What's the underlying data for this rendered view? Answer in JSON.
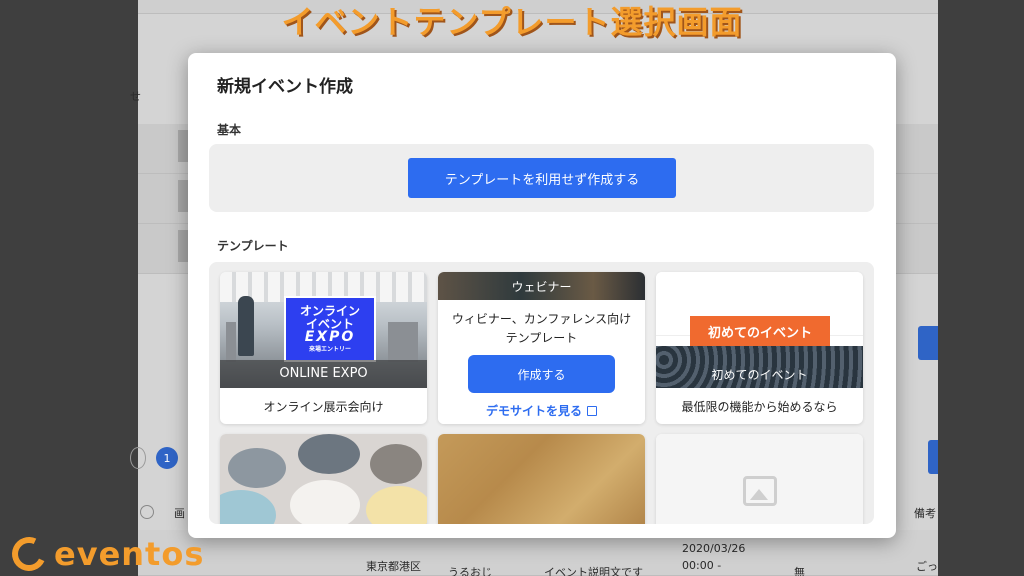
{
  "banner": {
    "title": "イベントテンプレート選択画面"
  },
  "background": {
    "header_fragment": "せ",
    "pagination_current": "1",
    "table_header_left": "画",
    "table_header_right": "備考",
    "row_location": "東京都港区",
    "row_org": "うるおじ",
    "row_desc": "イベント説明文です",
    "row_date": "2020/03/26",
    "row_time": "00:00 -",
    "row_flag": "無",
    "row_note": "ごっ"
  },
  "modal": {
    "title": "新規イベント作成",
    "section_basic": "基本",
    "create_without_template": "テンプレートを利用せず作成する",
    "section_template": "テンプレート",
    "templates": [
      {
        "overlay": "ONLINE EXPO",
        "caption": "オンライン展示会向け",
        "sign_line1": "オンライン",
        "sign_line2": "イベント",
        "sign_line3": "EXPO",
        "sign_line4": "来場エントリー"
      },
      {
        "overlay": "ウェビナー",
        "description_line1": "ウィビナー、カンファレンス向け",
        "description_line2": "テンプレート",
        "create_button": "作成する",
        "demo_link": "デモサイトを見る"
      },
      {
        "label": "初めてのイベント",
        "overlay": "初めてのイベント",
        "caption": "最低限の機能から始めるなら"
      }
    ]
  },
  "brand": {
    "logo_text": "eventos"
  },
  "colors": {
    "accent": "#2d6cf0",
    "brand_orange": "#f39c2c",
    "badge_orange": "#f06a2f"
  },
  "icons": {
    "external_link": "external-link-icon",
    "image_placeholder": "image-placeholder-icon"
  }
}
